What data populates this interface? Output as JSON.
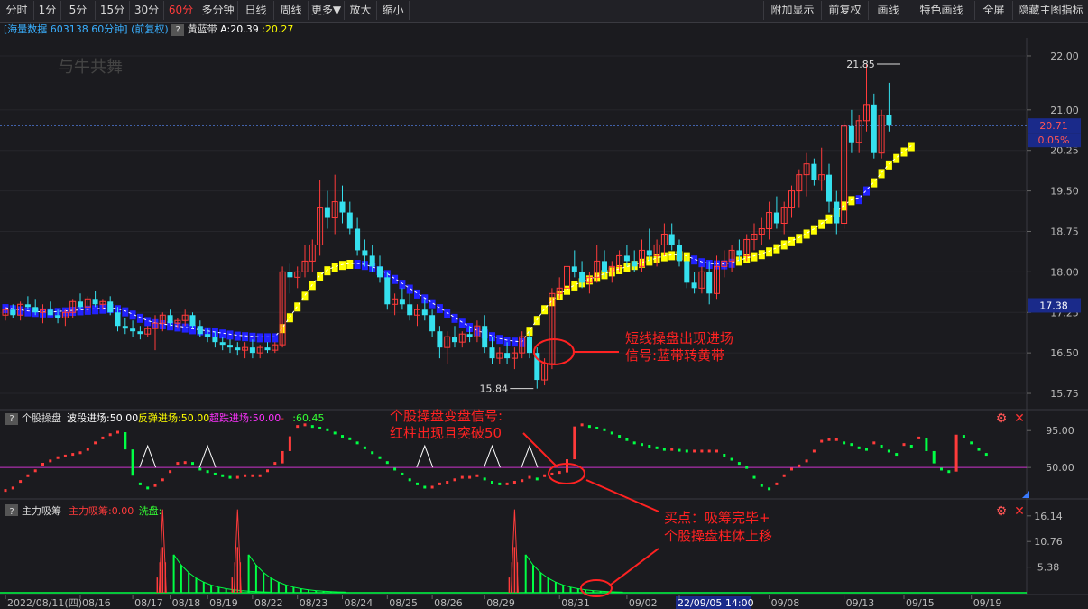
{
  "toolbar": {
    "left": [
      {
        "label": "分时",
        "active": false
      },
      {
        "label": "1分",
        "active": false
      },
      {
        "label": "5分",
        "active": false
      },
      {
        "label": "15分",
        "active": false
      },
      {
        "label": "30分",
        "active": false
      },
      {
        "label": "60分",
        "active": true
      },
      {
        "label": "多分钟",
        "active": false
      },
      {
        "label": "日线",
        "active": false
      },
      {
        "label": "周线",
        "active": false
      },
      {
        "label": "更多▼",
        "active": false
      },
      {
        "label": "放大",
        "active": false
      },
      {
        "label": "缩小",
        "active": false
      }
    ],
    "right": [
      {
        "label": "附加显示"
      },
      {
        "label": "前复权"
      },
      {
        "label": "画线"
      },
      {
        "label": "特色画线"
      },
      {
        "label": "全屏"
      },
      {
        "label": "隐藏主图指标"
      }
    ]
  },
  "header": {
    "title": "[海量数据 603138 60分钟]",
    "adjust": "(前复权)",
    "indicator_name": "黄蓝带",
    "a_value": "A:20.39",
    "b_value": ":20.27",
    "watermark": "与牛共舞"
  },
  "colors": {
    "up": "#ff3b3b",
    "down": "#35e0ee",
    "band_yellow": "#ffff00",
    "band_blue": "#2222ff",
    "ma_white": "#ffffff",
    "accent_red": "#ff2222",
    "purple": "#cc33cc",
    "green": "#00ff44"
  },
  "chart_data": [
    {
      "type": "candlestick",
      "panel": "main",
      "ylim": [
        15.55,
        22.2
      ],
      "y_ticks": [
        "22.00",
        "21.00",
        "20.25",
        "19.50",
        "18.75",
        "18.00",
        "17.25",
        "16.50",
        "15.75"
      ],
      "last_price": "20.71",
      "change_pct": "0.05%",
      "right_marker": "17.38",
      "high_label": "21.85",
      "low_label": "15.84",
      "band_values": [
        17.32,
        17.3,
        17.28,
        17.26,
        17.25,
        17.24,
        17.24,
        17.25,
        17.26,
        17.27,
        17.28,
        17.29,
        17.3,
        17.31,
        17.32,
        17.3,
        17.26,
        17.2,
        17.14,
        17.08,
        17.04,
        17.02,
        17.0,
        16.98,
        16.96,
        16.93,
        16.91,
        16.89,
        16.87,
        16.85,
        16.83,
        16.81,
        16.8,
        16.79,
        16.78,
        16.78,
        16.78,
        16.95,
        17.15,
        17.35,
        17.55,
        17.75,
        17.92,
        18.02,
        18.08,
        18.12,
        18.14,
        18.14,
        18.12,
        18.08,
        18.02,
        17.95,
        17.86,
        17.77,
        17.68,
        17.59,
        17.5,
        17.41,
        17.32,
        17.23,
        17.14,
        17.05,
        16.97,
        16.9,
        16.85,
        16.8,
        16.75,
        16.72,
        16.7,
        16.69,
        16.9,
        17.1,
        17.3,
        17.45,
        17.57,
        17.66,
        17.74,
        17.8,
        17.85,
        17.9,
        17.95,
        18.0,
        18.04,
        18.08,
        18.12,
        18.16,
        18.2,
        18.24,
        18.28,
        18.3,
        18.3,
        18.28,
        18.22,
        18.17,
        18.14,
        18.13,
        18.13,
        18.16,
        18.2,
        18.24,
        18.28,
        18.32,
        18.37,
        18.43,
        18.5,
        18.56,
        18.62,
        18.7,
        18.78,
        18.88,
        18.98,
        19.1,
        19.22,
        19.32,
        19.34,
        19.5,
        19.65,
        19.82,
        19.98,
        20.1,
        20.22,
        20.32
      ],
      "band_colors": "BBBBBBBBBBBBBBBBBBBBBBBBBBBBBBBBBBBBBYYYYYYYYYYBBBBBBBBBBBBBBBBBBBBBBBYYYYYYYYYYYYYYYYYYYYYYBBBBBBYYYYYYYYYYYYYYYYBBYYYYYYYY",
      "candles": [
        [
          17.2,
          17.35,
          17.1,
          17.3
        ],
        [
          17.3,
          17.4,
          17.15,
          17.2
        ],
        [
          17.2,
          17.45,
          17.1,
          17.4
        ],
        [
          17.4,
          17.55,
          17.3,
          17.35
        ],
        [
          17.35,
          17.5,
          17.2,
          17.25
        ],
        [
          17.25,
          17.4,
          17.05,
          17.3
        ],
        [
          17.3,
          17.45,
          17.2,
          17.2
        ],
        [
          17.2,
          17.3,
          17.05,
          17.15
        ],
        [
          17.15,
          17.3,
          17.0,
          17.25
        ],
        [
          17.25,
          17.5,
          17.15,
          17.45
        ],
        [
          17.45,
          17.6,
          17.3,
          17.35
        ],
        [
          17.35,
          17.55,
          17.25,
          17.5
        ],
        [
          17.5,
          17.65,
          17.35,
          17.4
        ],
        [
          17.4,
          17.5,
          17.3,
          17.45
        ],
        [
          17.45,
          17.55,
          17.2,
          17.25
        ],
        [
          17.25,
          17.35,
          16.9,
          17.0
        ],
        [
          17.0,
          17.15,
          16.85,
          16.95
        ],
        [
          16.95,
          17.1,
          16.8,
          16.9
        ],
        [
          16.9,
          17.0,
          16.75,
          16.85
        ],
        [
          16.85,
          17.0,
          16.8,
          16.95
        ],
        [
          16.95,
          17.2,
          16.55,
          17.05
        ],
        [
          17.05,
          17.25,
          16.9,
          17.2
        ],
        [
          17.2,
          17.3,
          17.0,
          17.05
        ],
        [
          17.05,
          17.15,
          16.95,
          17.1
        ],
        [
          17.1,
          17.3,
          17.0,
          17.2
        ],
        [
          17.2,
          17.25,
          16.95,
          17.0
        ],
        [
          17.0,
          17.1,
          16.8,
          16.85
        ],
        [
          16.85,
          16.95,
          16.7,
          16.8
        ],
        [
          16.8,
          16.9,
          16.6,
          16.7
        ],
        [
          16.7,
          16.8,
          16.55,
          16.65
        ],
        [
          16.65,
          16.75,
          16.5,
          16.6
        ],
        [
          16.6,
          16.7,
          16.45,
          16.55
        ],
        [
          16.55,
          16.7,
          16.4,
          16.6
        ],
        [
          16.6,
          16.75,
          16.4,
          16.5
        ],
        [
          16.5,
          16.65,
          16.4,
          16.6
        ],
        [
          16.6,
          16.7,
          16.5,
          16.55
        ],
        [
          16.55,
          16.7,
          16.5,
          16.65
        ],
        [
          16.65,
          18.1,
          16.6,
          18.0
        ],
        [
          18.0,
          18.15,
          17.6,
          17.9
        ],
        [
          17.9,
          18.1,
          17.7,
          18.0
        ],
        [
          18.0,
          18.5,
          17.9,
          18.2
        ],
        [
          18.2,
          18.6,
          18.0,
          18.5
        ],
        [
          18.5,
          19.7,
          18.3,
          19.2
        ],
        [
          19.2,
          19.5,
          18.8,
          19.0
        ],
        [
          19.0,
          19.8,
          18.7,
          19.3
        ],
        [
          19.3,
          19.6,
          18.9,
          19.1
        ],
        [
          19.1,
          19.3,
          18.7,
          18.8
        ],
        [
          18.8,
          19.0,
          18.3,
          18.4
        ],
        [
          18.4,
          18.6,
          18.1,
          18.3
        ],
        [
          18.3,
          18.5,
          18.0,
          18.1
        ],
        [
          18.1,
          18.3,
          17.8,
          17.9
        ],
        [
          17.9,
          18.0,
          17.3,
          17.4
        ],
        [
          17.4,
          17.6,
          17.2,
          17.5
        ],
        [
          17.5,
          17.7,
          17.3,
          17.4
        ],
        [
          17.4,
          17.6,
          17.1,
          17.2
        ],
        [
          17.2,
          17.4,
          17.0,
          17.3
        ],
        [
          17.3,
          17.5,
          17.1,
          17.2
        ],
        [
          17.2,
          17.3,
          16.8,
          16.9
        ],
        [
          16.9,
          17.0,
          16.4,
          16.6
        ],
        [
          16.6,
          16.9,
          16.3,
          16.8
        ],
        [
          16.8,
          17.0,
          16.6,
          16.7
        ],
        [
          16.7,
          16.9,
          16.6,
          16.85
        ],
        [
          16.85,
          17.0,
          16.7,
          16.8
        ],
        [
          16.8,
          17.1,
          16.7,
          17.0
        ],
        [
          17.0,
          17.2,
          16.5,
          16.6
        ],
        [
          16.6,
          16.8,
          16.3,
          16.4
        ],
        [
          16.4,
          16.6,
          16.3,
          16.5
        ],
        [
          16.5,
          16.7,
          16.3,
          16.4
        ],
        [
          16.4,
          16.6,
          16.2,
          16.5
        ],
        [
          16.5,
          16.9,
          16.4,
          16.8
        ],
        [
          16.8,
          16.9,
          16.4,
          16.5
        ],
        [
          16.5,
          16.6,
          15.84,
          16.0
        ],
        [
          16.0,
          16.4,
          15.9,
          16.3
        ],
        [
          16.3,
          17.7,
          16.2,
          17.6
        ],
        [
          17.6,
          17.9,
          17.5,
          17.7
        ],
        [
          17.7,
          18.3,
          17.6,
          18.1
        ],
        [
          18.1,
          18.4,
          17.9,
          18.0
        ],
        [
          18.0,
          18.2,
          17.7,
          17.8
        ],
        [
          17.8,
          18.0,
          17.6,
          17.9
        ],
        [
          17.9,
          18.5,
          17.8,
          18.2
        ],
        [
          18.2,
          18.4,
          17.9,
          18.0
        ],
        [
          18.0,
          18.2,
          17.8,
          18.1
        ],
        [
          18.1,
          18.4,
          18.0,
          18.3
        ],
        [
          18.3,
          18.5,
          18.1,
          18.2
        ],
        [
          18.2,
          18.4,
          18.0,
          18.1
        ],
        [
          18.1,
          18.6,
          18.0,
          18.4
        ],
        [
          18.4,
          18.8,
          18.2,
          18.3
        ],
        [
          18.3,
          18.6,
          18.1,
          18.5
        ],
        [
          18.5,
          18.9,
          18.3,
          18.7
        ],
        [
          18.7,
          18.9,
          18.4,
          18.5
        ],
        [
          18.5,
          18.6,
          18.1,
          18.2
        ],
        [
          18.2,
          18.3,
          17.7,
          17.8
        ],
        [
          17.8,
          18.0,
          17.6,
          17.7
        ],
        [
          17.7,
          18.1,
          17.6,
          18.0
        ],
        [
          18.0,
          18.2,
          17.4,
          17.6
        ],
        [
          17.6,
          18.3,
          17.5,
          18.1
        ],
        [
          18.1,
          18.4,
          17.9,
          18.2
        ],
        [
          18.2,
          18.5,
          18.0,
          18.4
        ],
        [
          18.4,
          18.6,
          18.2,
          18.3
        ],
        [
          18.3,
          18.7,
          18.2,
          18.6
        ],
        [
          18.6,
          18.9,
          18.4,
          18.7
        ],
        [
          18.7,
          19.0,
          18.5,
          18.8
        ],
        [
          18.8,
          19.3,
          18.6,
          19.1
        ],
        [
          19.1,
          19.4,
          18.8,
          18.9
        ],
        [
          18.9,
          19.3,
          18.7,
          19.2
        ],
        [
          19.2,
          19.6,
          19.0,
          19.5
        ],
        [
          19.5,
          19.9,
          19.2,
          19.8
        ],
        [
          19.8,
          20.2,
          19.4,
          20.0
        ],
        [
          20.0,
          20.1,
          19.6,
          19.7
        ],
        [
          19.7,
          20.3,
          19.5,
          19.8
        ],
        [
          19.8,
          20.0,
          19.1,
          19.3
        ],
        [
          19.3,
          19.5,
          18.7,
          18.9
        ],
        [
          18.9,
          20.8,
          18.8,
          20.7
        ],
        [
          20.7,
          21.0,
          20.2,
          20.4
        ],
        [
          20.4,
          20.9,
          20.2,
          20.8
        ],
        [
          20.8,
          21.85,
          20.6,
          21.1
        ],
        [
          21.1,
          21.3,
          20.1,
          20.2
        ],
        [
          20.2,
          21.0,
          20.1,
          20.9
        ],
        [
          20.9,
          21.5,
          20.6,
          20.71
        ]
      ],
      "annotation": {
        "line1": "短线操盘出现进场",
        "line2": "信号:蓝带转黄带"
      }
    },
    {
      "type": "bar",
      "panel": "indicator",
      "title": "个股操盘",
      "legend": [
        {
          "label": "波段进场:50.00",
          "color": "#ffffff"
        },
        {
          "label": "反弹进场:50.00",
          "color": "#ffff00"
        },
        {
          "label": "超跌进场:50.00",
          "color": "#ff33ff"
        },
        {
          "label": "-",
          "color": "#ff3b3b"
        },
        {
          "label": ":60.45",
          "color": "#33ff33"
        }
      ],
      "ylim": [
        15,
        115
      ],
      "y_ticks": [
        "95.00",
        "50.00"
      ],
      "threshold": 50,
      "values": [
        22,
        25,
        33,
        40,
        46,
        54,
        58,
        62,
        64,
        66,
        68,
        72,
        80,
        86,
        90,
        93,
        72,
        40,
        30,
        25,
        28,
        35,
        45,
        55,
        56,
        55,
        48,
        45,
        42,
        40,
        38,
        38,
        40,
        40,
        40,
        46,
        55,
        70,
        88,
        100,
        102,
        100,
        98,
        96,
        92,
        88,
        85,
        80,
        74,
        68,
        62,
        56,
        48,
        42,
        35,
        30,
        26,
        26,
        30,
        32,
        35,
        38,
        38,
        40,
        36,
        32,
        30,
        30,
        32,
        34,
        38,
        36,
        40,
        42,
        44,
        60,
        100,
        102,
        100,
        98,
        96,
        92,
        88,
        84,
        80,
        78,
        76,
        74,
        72,
        72,
        71,
        70,
        70,
        70,
        70,
        70,
        65,
        60,
        55,
        50,
        38,
        28,
        24,
        30,
        40,
        48,
        52,
        58,
        70,
        82,
        84,
        84,
        80,
        78,
        74,
        72,
        80,
        76,
        70,
        66,
        78,
        76,
        86,
        70,
        55,
        48,
        45,
        90,
        88,
        80,
        72,
        66
      ],
      "peaks": [
        19,
        27,
        56,
        65,
        70
      ],
      "annotation": {
        "line1": "个股操盘变盘信号:",
        "line2": "红柱出现且突破50"
      }
    },
    {
      "type": "bar",
      "panel": "volume",
      "title": "主力吸筹",
      "legend": [
        {
          "label": "主力吸筹:0.00",
          "color": "#ff3b3b"
        },
        {
          "label": "洗盘:",
          "color": "#33ff33"
        }
      ],
      "ylim": [
        0,
        18
      ],
      "y_ticks": [
        "16.14",
        "10.76",
        "5.38"
      ],
      "values": [
        0,
        0,
        0,
        0,
        0,
        0,
        0,
        0,
        0,
        0,
        0,
        0,
        0,
        0,
        0,
        0,
        0,
        0,
        0,
        0,
        0,
        0,
        0,
        0,
        0,
        0,
        0,
        0,
        0,
        0,
        0,
        0,
        0,
        0,
        0,
        0,
        0,
        0,
        0,
        0,
        0,
        0,
        0,
        0,
        0,
        0,
        0,
        0,
        0,
        0,
        0,
        0,
        0,
        0,
        0,
        0,
        0,
        0,
        0,
        0,
        0,
        0,
        0,
        0,
        0,
        0,
        0,
        0,
        0,
        0,
        0,
        0,
        0,
        0,
        0,
        0,
        0,
        0,
        0,
        0,
        0,
        0,
        0,
        0,
        0,
        0,
        0,
        0,
        0,
        0,
        0,
        0,
        0,
        0,
        0,
        0,
        0,
        0,
        0,
        0,
        0,
        0,
        0,
        0,
        0,
        0,
        0,
        0,
        0,
        0,
        0,
        0,
        0,
        0,
        0,
        0,
        0,
        0,
        0,
        0,
        0,
        0,
        0,
        0,
        0,
        0,
        0,
        0,
        0,
        0,
        0,
        0
      ],
      "annotation": {
        "line1": "买点：吸筹完毕+",
        "line2": "个股操盘柱体上移"
      }
    }
  ],
  "x_labels": [
    "2022/08/11(四)",
    "08/16",
    "08/17",
    "08/18",
    "08/19",
    "08/22",
    "08/23",
    "08/24",
    "08/25",
    "08/26",
    "08/29",
    "08/31",
    "09/02",
    "22/09/05 14:00",
    "09/08",
    "09/13",
    "09/15",
    "09/19"
  ],
  "x_label_positions": [
    0,
    10,
    17,
    22,
    27,
    33,
    39,
    45,
    51,
    57,
    64,
    74,
    83,
    90,
    102,
    112,
    120,
    129
  ],
  "spike_centers": [
    21,
    31,
    68
  ]
}
